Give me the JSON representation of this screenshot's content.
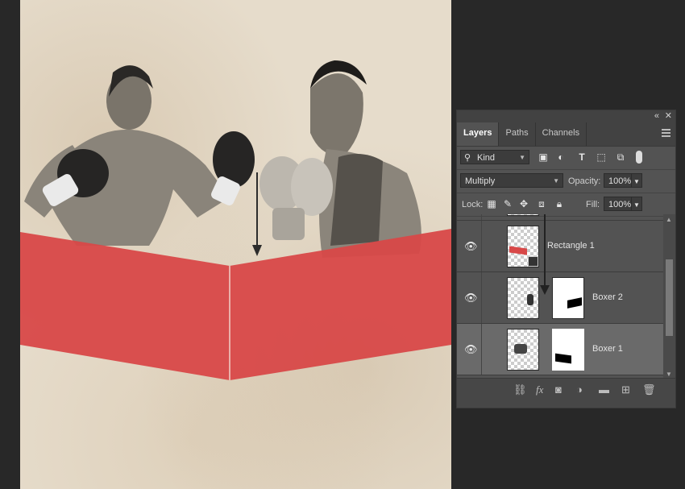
{
  "panel": {
    "collapse_glyph": "«",
    "close_glyph": "✕",
    "tabs": [
      {
        "label": "Layers",
        "active": true
      },
      {
        "label": "Paths",
        "active": false
      },
      {
        "label": "Channels",
        "active": false
      }
    ],
    "filter": {
      "label": "Kind",
      "icon": "search-icon"
    },
    "blend_mode": "Multiply",
    "opacity_label": "Opacity:",
    "opacity_value": "100%",
    "lock_label": "Lock:",
    "fill_label": "Fill:",
    "fill_value": "100%",
    "layers": [
      {
        "name": "Rectangle 1",
        "visible": true,
        "selected": false,
        "has_mask": false
      },
      {
        "name": "Boxer 2",
        "visible": true,
        "selected": false,
        "has_mask": true
      },
      {
        "name": "Boxer 1",
        "visible": true,
        "selected": true,
        "has_mask": true
      }
    ]
  },
  "colors": {
    "banner_red": "#d84848",
    "paper": "#e6dccb",
    "panel_bg": "#535353",
    "selected_layer": "#6a6a6a"
  }
}
